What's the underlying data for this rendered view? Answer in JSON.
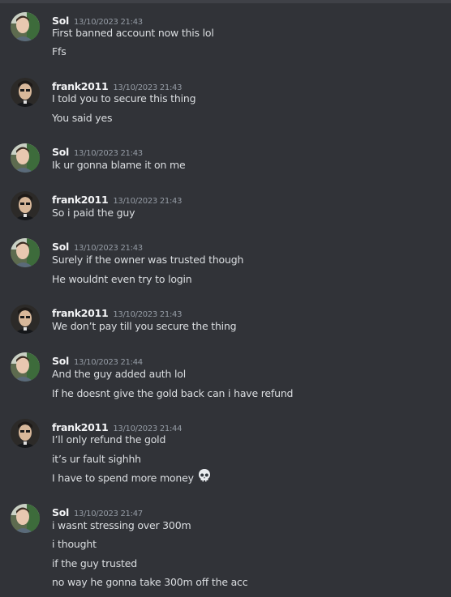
{
  "messages": [
    {
      "author": "Sol",
      "timestamp": "13/10/2023 21:43",
      "avatar_icon": "sol-avatar-icon",
      "lines": [
        "First banned account now this lol",
        "Ffs"
      ]
    },
    {
      "author": "frank2011",
      "timestamp": "13/10/2023 21:43",
      "avatar_icon": "frank-avatar-icon",
      "lines": [
        "I told you to secure this thing",
        "You said yes"
      ]
    },
    {
      "author": "Sol",
      "timestamp": "13/10/2023 21:43",
      "avatar_icon": "sol-avatar-icon",
      "lines": [
        "Ik ur gonna blame it on me"
      ]
    },
    {
      "author": "frank2011",
      "timestamp": "13/10/2023 21:43",
      "avatar_icon": "frank-avatar-icon",
      "lines": [
        "So i paid the guy"
      ]
    },
    {
      "author": "Sol",
      "timestamp": "13/10/2023 21:43",
      "avatar_icon": "sol-avatar-icon",
      "lines": [
        "Surely if the owner was trusted though",
        "He wouldnt even try to login"
      ]
    },
    {
      "author": "frank2011",
      "timestamp": "13/10/2023 21:43",
      "avatar_icon": "frank-avatar-icon",
      "lines": [
        "We don’t pay till you secure the thing"
      ]
    },
    {
      "author": "Sol",
      "timestamp": "13/10/2023 21:44",
      "avatar_icon": "sol-avatar-icon",
      "lines": [
        "And the guy added auth lol",
        "If he doesnt give the gold back can i have refund"
      ]
    },
    {
      "author": "frank2011",
      "timestamp": "13/10/2023 21:44",
      "avatar_icon": "frank-avatar-icon",
      "lines": [
        "I’ll only refund the gold",
        "it’s ur fault sighhh",
        "I have to spend more money"
      ],
      "emoji": {
        "line": 2,
        "icon": "skull-emoji-icon"
      }
    },
    {
      "author": "Sol",
      "timestamp": "13/10/2023 21:47",
      "avatar_icon": "sol-avatar-icon",
      "lines": [
        "i wasnt stressing over 300m",
        "i thought",
        "if the guy trusted",
        "no way he gonna take 300m off the acc"
      ]
    }
  ],
  "colors": {
    "background": "#313338",
    "username": "#f2f3f5",
    "timestamp": "#949ba4",
    "text": "#dbdee1"
  }
}
